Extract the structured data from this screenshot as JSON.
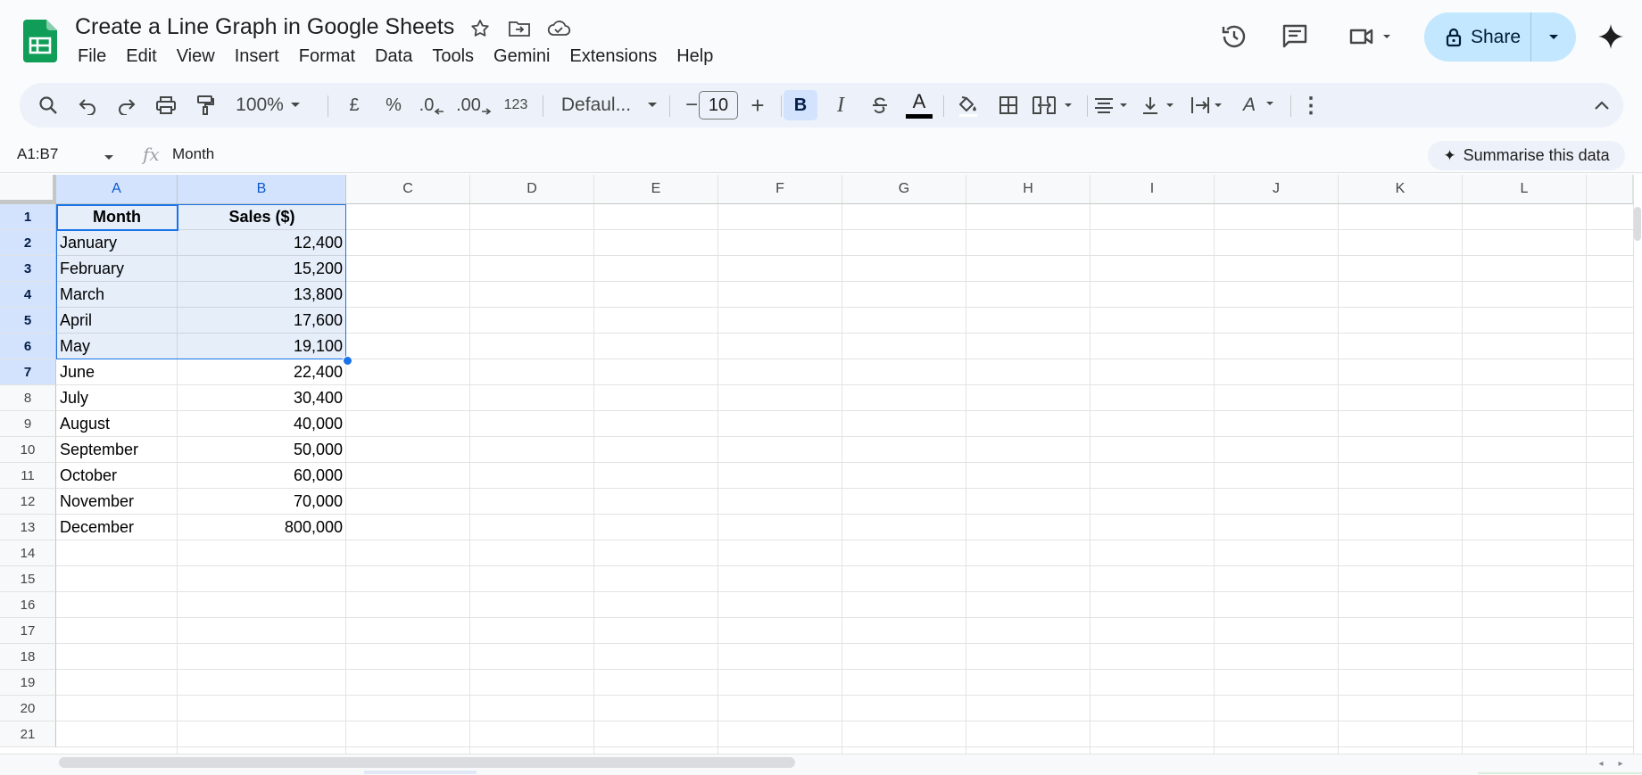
{
  "document": {
    "title": "Create a Line Graph in Google Sheets"
  },
  "menu": [
    "File",
    "Edit",
    "View",
    "Insert",
    "Format",
    "Data",
    "Tools",
    "Gemini",
    "Extensions",
    "Help"
  ],
  "share": {
    "label": "Share"
  },
  "toolbar": {
    "zoom": "100%",
    "currency": "£",
    "percent": "%",
    "dec_decrease": ".0",
    "dec_increase": ".00",
    "number_format": "123",
    "font": "Defaul...",
    "font_size": "10",
    "minus": "−",
    "plus": "+",
    "bold": "B",
    "italic": "I",
    "text_color": "A",
    "text_rotation": "A",
    "more": "⋮"
  },
  "formula_bar": {
    "name_box": "A1:B7",
    "fx": "fx",
    "value": "Month",
    "summarise_label": "Summarise this data"
  },
  "grid": {
    "columns": [
      "A",
      "B",
      "C",
      "D",
      "E",
      "F",
      "G",
      "H",
      "I",
      "J",
      "K",
      "L"
    ],
    "selected_columns": [
      "A",
      "B"
    ],
    "row_numbers": [
      "1",
      "2",
      "3",
      "4",
      "5",
      "6",
      "7",
      "8",
      "9",
      "10",
      "11",
      "12",
      "13",
      "14",
      "15",
      "16",
      "17",
      "18",
      "19",
      "20",
      "21"
    ],
    "selected_rows": 7,
    "headers": {
      "a": "Month",
      "b": "Sales ($)"
    },
    "rows": [
      {
        "month": "January",
        "sales": "12,400"
      },
      {
        "month": "February",
        "sales": "15,200"
      },
      {
        "month": "March",
        "sales": "13,800"
      },
      {
        "month": "April",
        "sales": "17,600"
      },
      {
        "month": "May",
        "sales": "19,100"
      },
      {
        "month": "June",
        "sales": "22,400"
      },
      {
        "month": "July",
        "sales": "30,400"
      },
      {
        "month": "August",
        "sales": "40,000"
      },
      {
        "month": "September",
        "sales": "50,000"
      },
      {
        "month": "October",
        "sales": "60,000"
      },
      {
        "month": "November",
        "sales": "70,000"
      },
      {
        "month": "December",
        "sales": "800,000"
      }
    ]
  },
  "colors": {
    "accent": "#1a73e8",
    "selection_header": "#d3e3fd",
    "share_bg": "#c2e7ff",
    "sheets_green": "#0f9d58"
  }
}
